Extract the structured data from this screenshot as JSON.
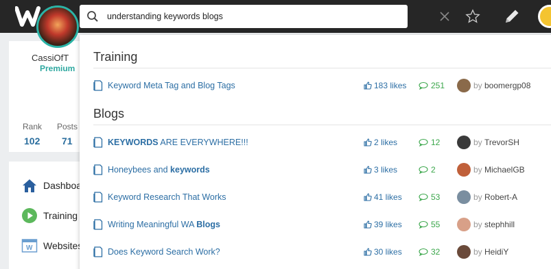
{
  "search": {
    "value": "understanding keywords blogs"
  },
  "profile": {
    "name": "CassiOfT",
    "status": "Premium",
    "rank_label": "Rank",
    "rank_value": "102",
    "posts_label": "Posts",
    "posts_value": "71"
  },
  "nav": [
    {
      "label": "Dashboa",
      "icon": "home-icon"
    },
    {
      "label": "Training",
      "icon": "play-icon"
    },
    {
      "label": "Websites",
      "icon": "website-icon"
    }
  ],
  "dropdown": {
    "training_title": "Training",
    "blogs_title": "Blogs",
    "training_items": [
      {
        "title_parts": [
          [
            "Keyword Meta Tag and Blog Tags",
            false
          ]
        ],
        "likes": "183 likes",
        "comments": "251",
        "by": "by",
        "user": "boomergp08",
        "avatar_color": "#8a6a4a"
      }
    ],
    "blog_items": [
      {
        "title_parts": [
          [
            "KEYWORDS",
            true
          ],
          [
            " ARE EVERYWHERE!!!",
            false
          ]
        ],
        "likes": "2 likes",
        "comments": "12",
        "by": "by",
        "user": "TrevorSH",
        "avatar_color": "#3a3a3a"
      },
      {
        "title_parts": [
          [
            "Honeybees and ",
            false
          ],
          [
            "keywords",
            true
          ]
        ],
        "likes": "3 likes",
        "comments": "2",
        "by": "by",
        "user": "MichaelGB",
        "avatar_color": "#c0603a"
      },
      {
        "title_parts": [
          [
            "Keyword Research That Works",
            false
          ]
        ],
        "likes": "41 likes",
        "comments": "53",
        "by": "by",
        "user": "Robert-A",
        "avatar_color": "#7a8ea0"
      },
      {
        "title_parts": [
          [
            "Writing Meaningful WA ",
            false
          ],
          [
            "Blogs",
            true
          ]
        ],
        "likes": "39 likes",
        "comments": "55",
        "by": "by",
        "user": "stephhill",
        "avatar_color": "#d8a088"
      },
      {
        "title_parts": [
          [
            "Does Keyword Search Work?",
            false
          ]
        ],
        "likes": "30 likes",
        "comments": "32",
        "by": "by",
        "user": "HeidiY",
        "avatar_color": "#6a4a3a"
      }
    ]
  },
  "colors": {
    "link": "#2c6ea4",
    "comment": "#3aa64a",
    "topbar": "#262626",
    "premium": "#2ea8a0"
  }
}
